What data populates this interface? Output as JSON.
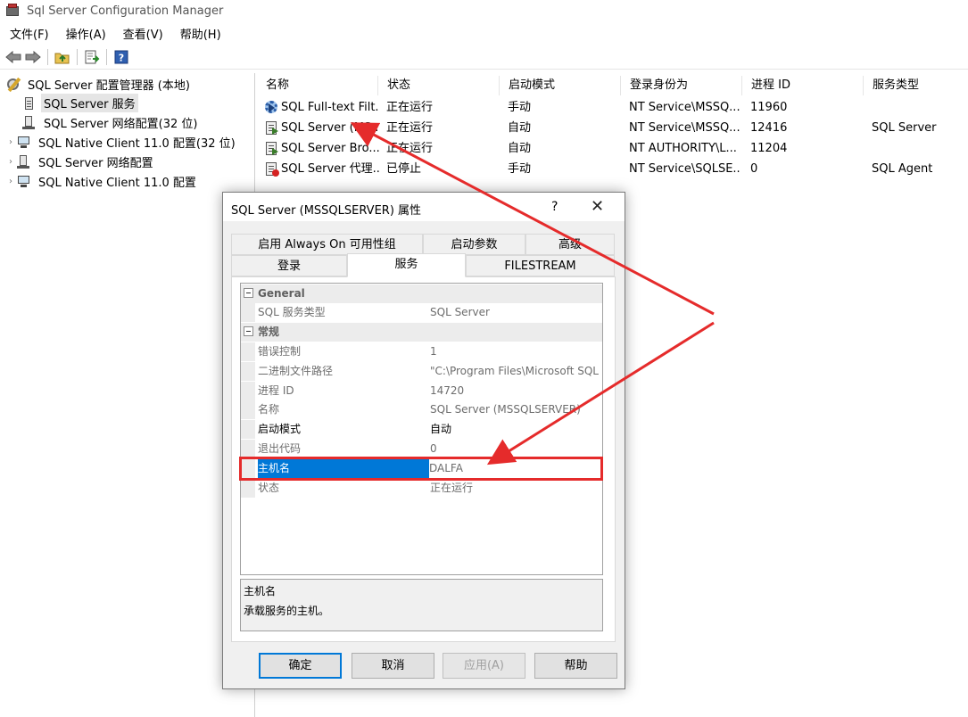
{
  "window": {
    "title": "Sql Server Configuration Manager"
  },
  "menu": [
    "文件(F)",
    "操作(A)",
    "查看(V)",
    "帮助(H)"
  ],
  "toolbar": [
    "back-icon",
    "forward-icon",
    "up-folder-icon",
    "export-list-icon",
    "help-icon"
  ],
  "tree": {
    "root": "SQL Server 配置管理器 (本地)",
    "items": [
      {
        "label": "SQL Server 服务",
        "selected": true,
        "icon": "server-icon"
      },
      {
        "label": "SQL Server 网络配置(32 位)",
        "icon": "network-icon"
      },
      {
        "label": "SQL Native Client 11.0 配置(32 位)",
        "icon": "client-icon"
      },
      {
        "label": "SQL Server 网络配置",
        "icon": "network-icon"
      },
      {
        "label": "SQL Native Client 11.0 配置",
        "icon": "client-icon"
      }
    ]
  },
  "list": {
    "columns": [
      "名称",
      "状态",
      "启动模式",
      "登录身份为",
      "进程 ID",
      "服务类型"
    ],
    "rows": [
      {
        "name": "SQL Full-text Filt...",
        "state": "正在运行",
        "start": "手动",
        "logon": "NT Service\\MSSQ...",
        "pid": "11960",
        "type": "",
        "icon": "gear-running"
      },
      {
        "name": "SQL Server (MS...",
        "state": "正在运行",
        "start": "自动",
        "logon": "NT Service\\MSSQ...",
        "pid": "12416",
        "type": "SQL Server",
        "icon": "server-running"
      },
      {
        "name": "SQL Server Bro...",
        "state": "正在运行",
        "start": "自动",
        "logon": "NT AUTHORITY\\L...",
        "pid": "11204",
        "type": "",
        "icon": "server-running"
      },
      {
        "name": "SQL Server 代理...",
        "state": "已停止",
        "start": "手动",
        "logon": "NT Service\\SQLSE...",
        "pid": "0",
        "type": "SQL Agent",
        "icon": "server-stopped"
      }
    ]
  },
  "dialog": {
    "title": "SQL Server (MSSQLSERVER) 属性",
    "help": "?",
    "close": "✕",
    "tabs_row1": [
      "启用 Always On 可用性组",
      "启动参数",
      "高级"
    ],
    "tabs_row2": [
      "登录",
      "服务",
      "FILESTREAM"
    ],
    "active_tab": "服务",
    "groups": [
      {
        "name": "General",
        "props": [
          {
            "k": "SQL 服务类型",
            "v": "SQL Server"
          }
        ]
      },
      {
        "name": "常规",
        "props": [
          {
            "k": "错误控制",
            "v": "1"
          },
          {
            "k": "二进制文件路径",
            "v": "\"C:\\Program Files\\Microsoft SQL S"
          },
          {
            "k": "进程 ID",
            "v": "14720"
          },
          {
            "k": "名称",
            "v": "SQL Server (MSSQLSERVER)"
          },
          {
            "k": "启动模式",
            "v": "自动"
          },
          {
            "k": "退出代码",
            "v": "0"
          },
          {
            "k": "主机名",
            "v": "DALFA"
          },
          {
            "k": "状态",
            "v": "正在运行"
          }
        ]
      }
    ],
    "description": {
      "title": "主机名",
      "text": "承载服务的主机。"
    },
    "buttons": {
      "ok": "确定",
      "cancel": "取消",
      "apply": "应用(A)",
      "help": "帮助"
    }
  },
  "annotation_color": "#e52b2b",
  "selection_color": "#0078d7"
}
